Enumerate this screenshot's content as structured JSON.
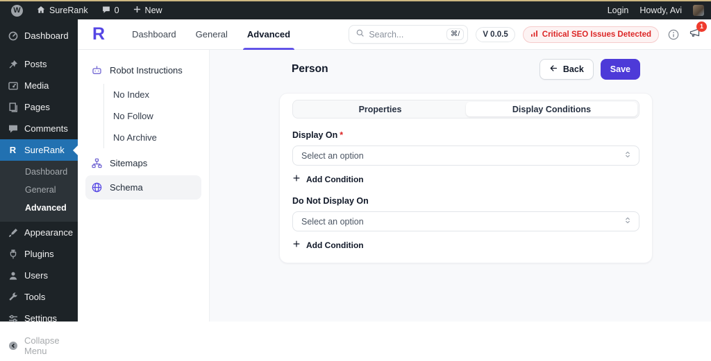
{
  "colors": {
    "accent": "#5546e4",
    "wp_active_blue": "#2271b1",
    "alert_red": "#dc2626",
    "admin_dark": "#1d2327"
  },
  "admin_bar": {
    "wp_logo_letter": "W",
    "site_name": "SureRank",
    "comments_count": "0",
    "new_label": "New",
    "login_label": "Login",
    "howdy_label": "Howdy, Avi"
  },
  "wp_sidebar": {
    "items_top": [
      {
        "label": "Dashboard"
      },
      {
        "label": "Posts"
      },
      {
        "label": "Media"
      },
      {
        "label": "Pages"
      },
      {
        "label": "Comments"
      }
    ],
    "surerank": {
      "label": "SureRank",
      "logo_letter": "R"
    },
    "surerank_submenu": [
      {
        "label": "Dashboard"
      },
      {
        "label": "General"
      },
      {
        "label": "Advanced"
      }
    ],
    "items_bottom": [
      {
        "label": "Appearance"
      },
      {
        "label": "Plugins"
      },
      {
        "label": "Users"
      },
      {
        "label": "Tools"
      },
      {
        "label": "Settings"
      }
    ],
    "collapse_label": "Collapse Menu"
  },
  "plugin_header": {
    "logo_letter": "R",
    "tabs": [
      {
        "label": "Dashboard"
      },
      {
        "label": "General"
      },
      {
        "label": "Advanced"
      }
    ],
    "search_placeholder": "Search...",
    "search_shortcut": "⌘/",
    "version": "V 0.0.5",
    "alert_label": "Critical SEO Issues Detected",
    "notification_count": "1"
  },
  "plugin_sidebar": {
    "robot_label": "Robot Instructions",
    "robot_children": [
      {
        "label": "No Index"
      },
      {
        "label": "No Follow"
      },
      {
        "label": "No Archive"
      }
    ],
    "sitemaps_label": "Sitemaps",
    "schema_label": "Schema"
  },
  "main": {
    "title": "Person",
    "back_label": "Back",
    "save_label": "Save",
    "tab_properties": "Properties",
    "tab_display_conditions": "Display Conditions",
    "display_on": {
      "label": "Display On",
      "required_mark": "*",
      "placeholder": "Select an option",
      "add_label": "Add Condition"
    },
    "do_not_display_on": {
      "label": "Do Not Display On",
      "placeholder": "Select an option",
      "add_label": "Add Condition"
    }
  }
}
